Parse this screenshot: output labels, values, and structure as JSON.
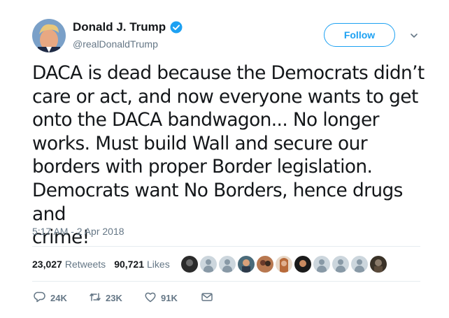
{
  "user": {
    "display_name": "Donald J. Trump",
    "handle": "@realDonaldTrump",
    "verified": true
  },
  "follow_button": {
    "label": "Follow"
  },
  "tweet": {
    "lines": [
      "DACA is dead because the Democrats didn’t",
      "care or act, and now everyone wants to get",
      "onto the DACA bandwagon... No longer",
      "works. Must build Wall and secure our",
      "borders with proper Border legislation.",
      "Democrats want No Borders, hence drugs and",
      "crime!"
    ],
    "timestamp": "5:17 AM - 2 Apr 2018"
  },
  "stats": {
    "retweets_count": "23,027",
    "retweets_label": "Retweets",
    "likes_count": "90,721",
    "likes_label": "Likes"
  },
  "actions": {
    "reply_count": "24K",
    "retweet_count": "23K",
    "like_count": "91K"
  },
  "colors": {
    "accent": "#1da1f2",
    "secondary_text": "#657786",
    "divider": "#e6ecf0"
  }
}
